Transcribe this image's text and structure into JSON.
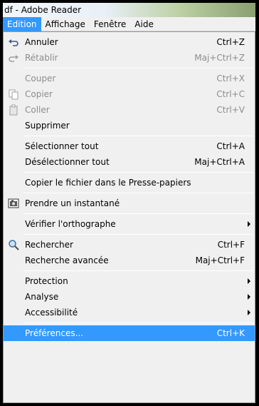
{
  "window": {
    "title": "df - Adobe Reader"
  },
  "menubar": {
    "items": [
      {
        "label": "Edition"
      },
      {
        "label": "Affichage"
      },
      {
        "label": "Fenêtre"
      },
      {
        "label": "Aide"
      }
    ]
  },
  "menu": {
    "items": [
      {
        "label": "Annuler",
        "shortcut": "Ctrl+Z",
        "icon": "undo-icon"
      },
      {
        "label": "Rétablir",
        "shortcut": "Maj+Ctrl+Z",
        "icon": "redo-icon"
      },
      {
        "label": "Couper",
        "shortcut": "Ctrl+X"
      },
      {
        "label": "Copier",
        "shortcut": "Ctrl+C",
        "icon": "copy-icon"
      },
      {
        "label": "Coller",
        "shortcut": "Ctrl+V",
        "icon": "paste-icon"
      },
      {
        "label": "Supprimer",
        "shortcut": ""
      },
      {
        "label": "Sélectionner tout",
        "shortcut": "Ctrl+A"
      },
      {
        "label": "Désélectionner tout",
        "shortcut": "Maj+Ctrl+A"
      },
      {
        "label": "Copier le fichier dans le Presse-papiers",
        "shortcut": ""
      },
      {
        "label": "Prendre un instantané",
        "shortcut": "",
        "icon": "camera-icon"
      },
      {
        "label": "Vérifier l'orthographe",
        "shortcut": ""
      },
      {
        "label": "Rechercher",
        "shortcut": "Ctrl+F",
        "icon": "search-icon"
      },
      {
        "label": "Recherche avancée",
        "shortcut": "Maj+Ctrl+F"
      },
      {
        "label": "Protection",
        "shortcut": ""
      },
      {
        "label": "Analyse",
        "shortcut": ""
      },
      {
        "label": "Accessibilité",
        "shortcut": ""
      },
      {
        "label": "Préférences...",
        "shortcut": "Ctrl+K"
      }
    ]
  },
  "colors": {
    "highlight": "#3399ff",
    "menu_bg": "#f0f0f0",
    "disabled_text": "#8d8d8d"
  }
}
